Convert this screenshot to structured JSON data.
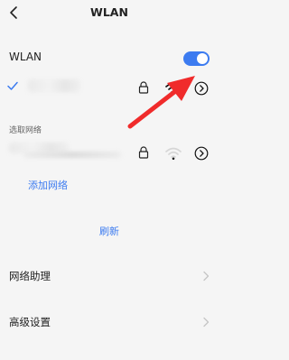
{
  "header": {
    "title": "WLAN",
    "back_icon": "chevron-left-icon"
  },
  "wlan_toggle": {
    "label": "WLAN",
    "state": "on",
    "accent": "#3c7bf0"
  },
  "connected_network": {
    "selected": true,
    "check_icon": "checkmark-icon",
    "lock_icon": "lock-icon",
    "signal_icon": "wifi-signal-full-icon",
    "detail_icon": "chevron-circle-right-icon"
  },
  "available_section": {
    "label": "选取网络",
    "networks": [
      {
        "lock_icon": "lock-icon",
        "signal_icon": "wifi-signal-weak-icon",
        "detail_icon": "chevron-circle-right-icon"
      }
    ]
  },
  "actions": {
    "add_network": "添加网络",
    "refresh": "刷新"
  },
  "menu": [
    {
      "label": "网络助理"
    },
    {
      "label": "高级设置"
    }
  ],
  "annotation": {
    "arrow_icon": "red-arrow-icon",
    "color": "#f02b2b"
  }
}
